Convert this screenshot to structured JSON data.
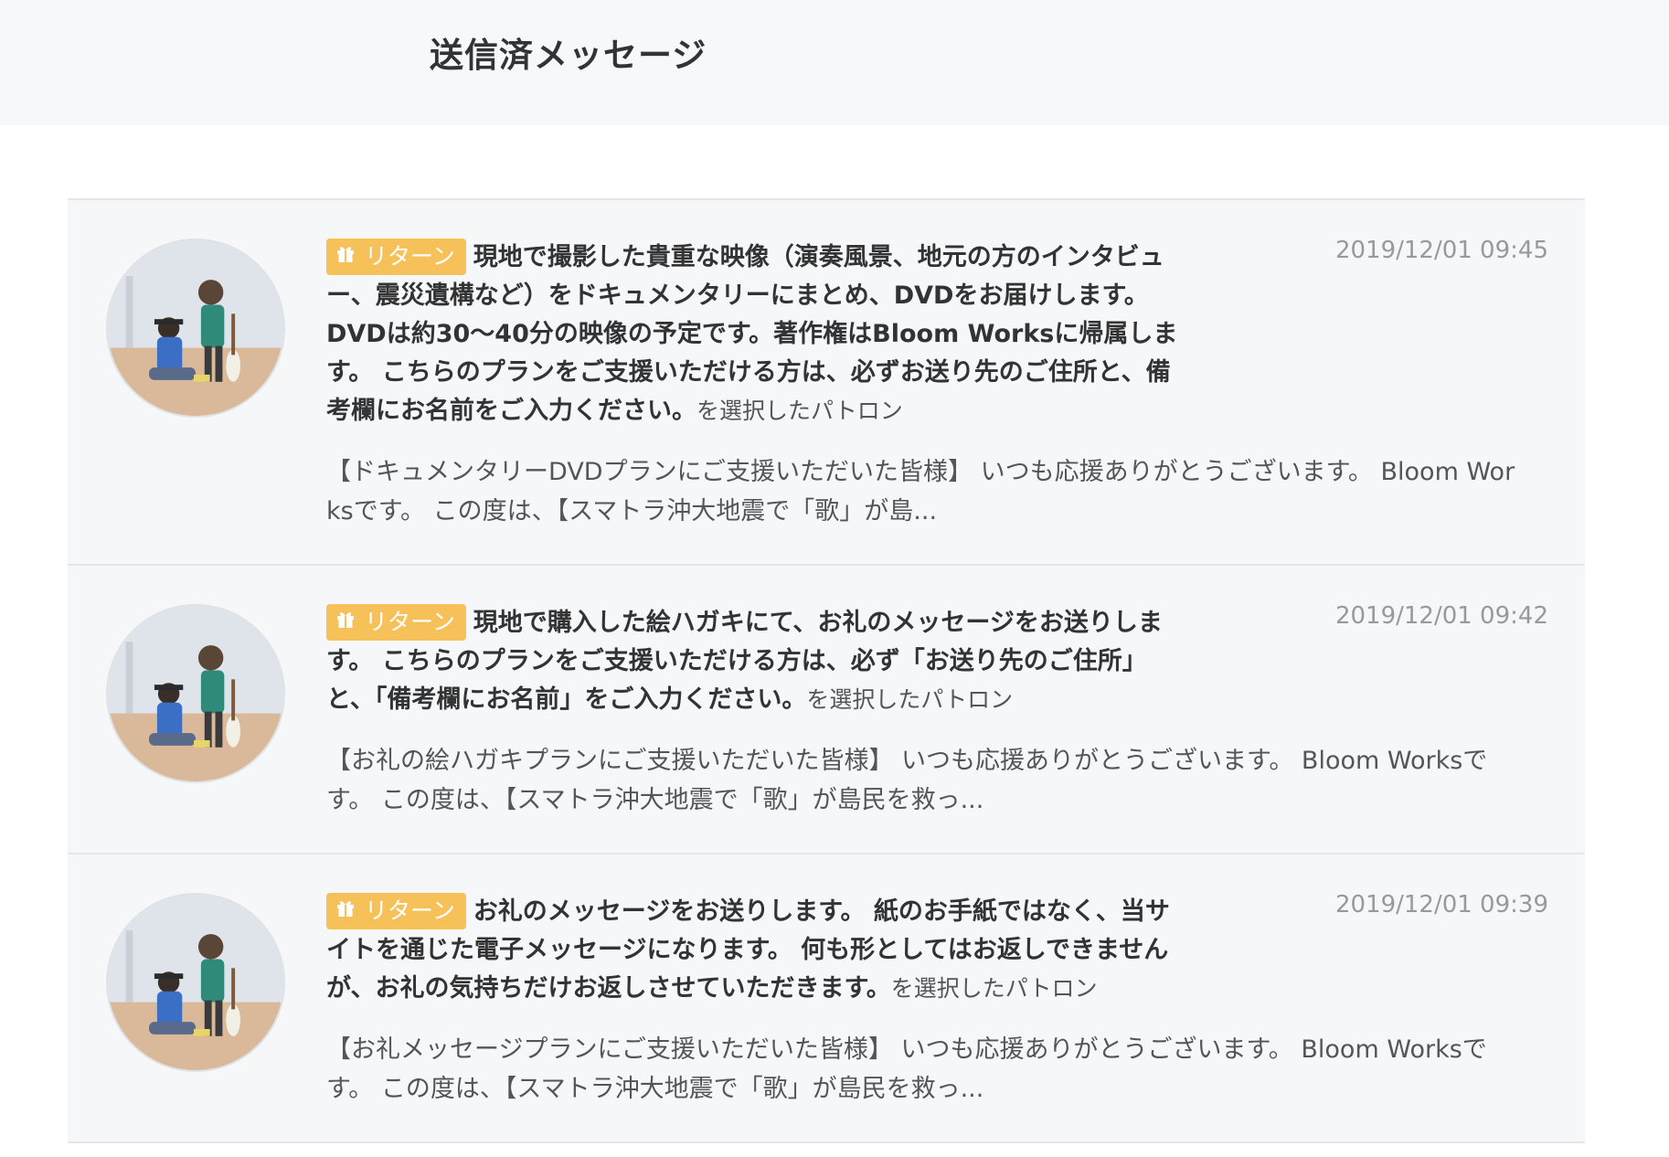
{
  "page": {
    "title": "送信済メッセージ"
  },
  "colors": {
    "badge": "#f7c15a",
    "header_bg": "#f6f8fa",
    "item_bg": "#f6f7f9",
    "timestamp": "#999999"
  },
  "messages": [
    {
      "badge_label": "リターン",
      "badge_icon": "gift-icon",
      "avatar_icon": "patron-avatar",
      "plan_title": "現地で撮影した貴重な映像（演奏風景、地元の方のインタビュー、震災遺構など）をドキュメンタリーにまとめ、DVDをお届けします。 DVDは約30〜40分の映像の予定です。著作権はBloom Worksに帰属します。 こちらのプランをご支援いただける方は、必ずお送り先のご住所と、備考欄にお名前をご入力ください。",
      "suffix": "を選択したパトロン",
      "timestamp": "2019/12/01 09:45",
      "excerpt": "【ドキュメンタリーDVDプランにご支援いただいた皆様】 いつも応援ありがとうございます。 Bloom Worksです。 この度は、【スマトラ沖大地震で「歌」が島..."
    },
    {
      "badge_label": "リターン",
      "badge_icon": "gift-icon",
      "avatar_icon": "patron-avatar",
      "plan_title": "現地で購入した絵ハガキにて、お礼のメッセージをお送りします。 こちらのプランをご支援いただける方は、必ず「お送り先のご住所」と、「備考欄にお名前」をご入力ください。",
      "suffix": "を選択したパトロン",
      "timestamp": "2019/12/01 09:42",
      "excerpt": "【お礼の絵ハガキプランにご支援いただいた皆様】 いつも応援ありがとうございます。 Bloom Worksです。 この度は、【スマトラ沖大地震で「歌」が島民を救っ..."
    },
    {
      "badge_label": "リターン",
      "badge_icon": "gift-icon",
      "avatar_icon": "patron-avatar",
      "plan_title": "お礼のメッセージをお送りします。 紙のお手紙ではなく、当サイトを通じた電子メッセージになります。 何も形としてはお返しできませんが、お礼の気持ちだけお返しさせていただきます。",
      "suffix": "を選択したパトロン",
      "timestamp": "2019/12/01 09:39",
      "excerpt": "【お礼メッセージプランにご支援いただいた皆様】 いつも応援ありがとうございます。 Bloom Worksです。 この度は、【スマトラ沖大地震で「歌」が島民を救っ..."
    }
  ]
}
